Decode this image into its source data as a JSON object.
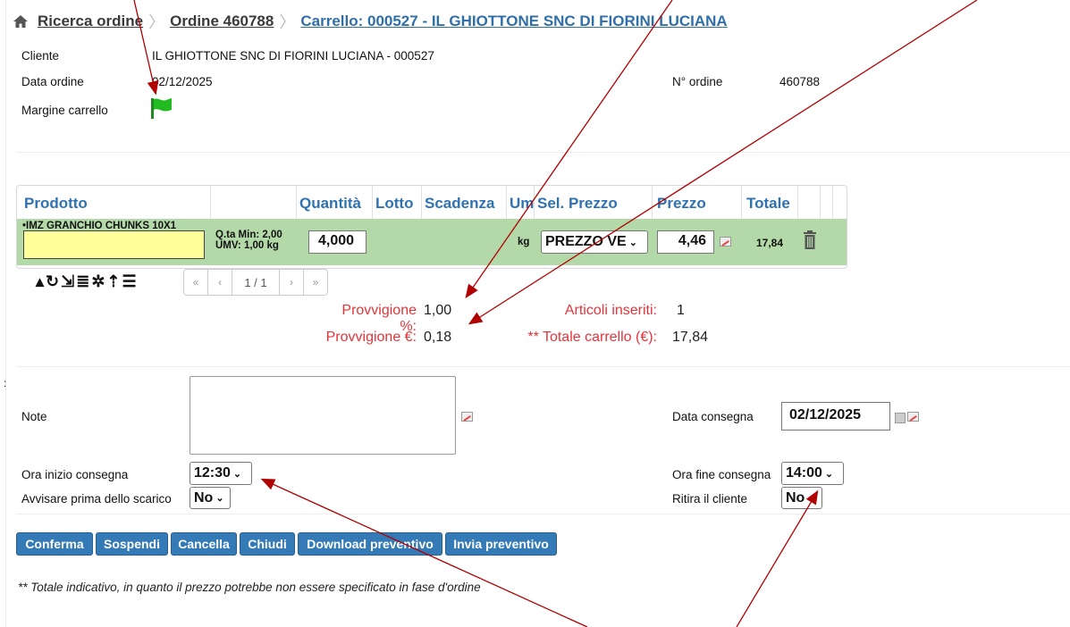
{
  "breadcrumb": {
    "item1": "Ricerca ordine",
    "item2": "Ordine 460788",
    "item3": "Carrello: 000527 - IL GHIOTTONE SNC DI FIORINI LUCIANA"
  },
  "header": {
    "cliente_label": "Cliente",
    "cliente_value": "IL GHIOTTONE SNC DI FIORINI LUCIANA - 000527",
    "data_label": "Data ordine",
    "data_value": "02/12/2025",
    "nordine_label": "N° ordine",
    "nordine_value": "460788",
    "margine_label": "Margine carrello"
  },
  "table": {
    "headers": [
      "Prodotto",
      "Quantità",
      "Lotto",
      "Scadenza",
      "Um",
      "Sel. Prezzo",
      "Prezzo",
      "Totale"
    ],
    "row": {
      "product": "•IMZ GRANCHIO CHUNKS 10X1",
      "qta_min": "Q.ta Min: 2,00",
      "umv": "UMV: 1,00 kg",
      "quantita": "4,000",
      "um": "kg",
      "sel_prezzo": "PREZZO VE",
      "prezzo": "4,46",
      "totale": "17,84"
    }
  },
  "pager": {
    "first": "«",
    "prev": "‹",
    "page": "1 / 1",
    "next": "›",
    "last": "»"
  },
  "summary": {
    "provv_pct_label": "Provvigione %:",
    "provv_pct_value": "1,00",
    "provv_eur_label": "Provvigione €:",
    "provv_eur_value": "0,18",
    "articoli_label": "Articoli inseriti:",
    "articoli_value": "1",
    "totale_label": "** Totale carrello (€):",
    "totale_value": "17,84"
  },
  "form": {
    "note_label": "Note",
    "data_consegna_label": "Data consegna",
    "data_consegna_value": "02/12/2025",
    "ora_inizio_label": "Ora inizio consegna",
    "ora_inizio_value": "12:30",
    "ora_fine_label": "Ora fine consegna",
    "ora_fine_value": "14:00",
    "avvisare_label": "Avvisare prima dello scarico",
    "avvisare_value": "No",
    "ritira_label": "Ritira il cliente",
    "ritira_value": "No"
  },
  "buttons": {
    "conferma": "Conferma",
    "sospendi": "Sospendi",
    "cancella": "Cancella",
    "chiudi": "Chiudi",
    "download": "Download preventivo",
    "invia": "Invia preventivo"
  },
  "footnote": "** Totale indicativo, in quanto il prezzo potrebbe non essere specificato in fase d'ordine",
  "colors": {
    "accent": "#337ab7",
    "row_bg": "#b4d9a8",
    "highlight_input": "#ffff99",
    "summary_red": "#e2353a",
    "flag_green": "#22bb22",
    "arrow_red": "#b00000"
  },
  "icons": [
    "home-icon",
    "flag-icon",
    "trash-icon",
    "edit-icon",
    "calendar-icon",
    "refresh-icon",
    "settings-icon",
    "database-icon"
  ]
}
